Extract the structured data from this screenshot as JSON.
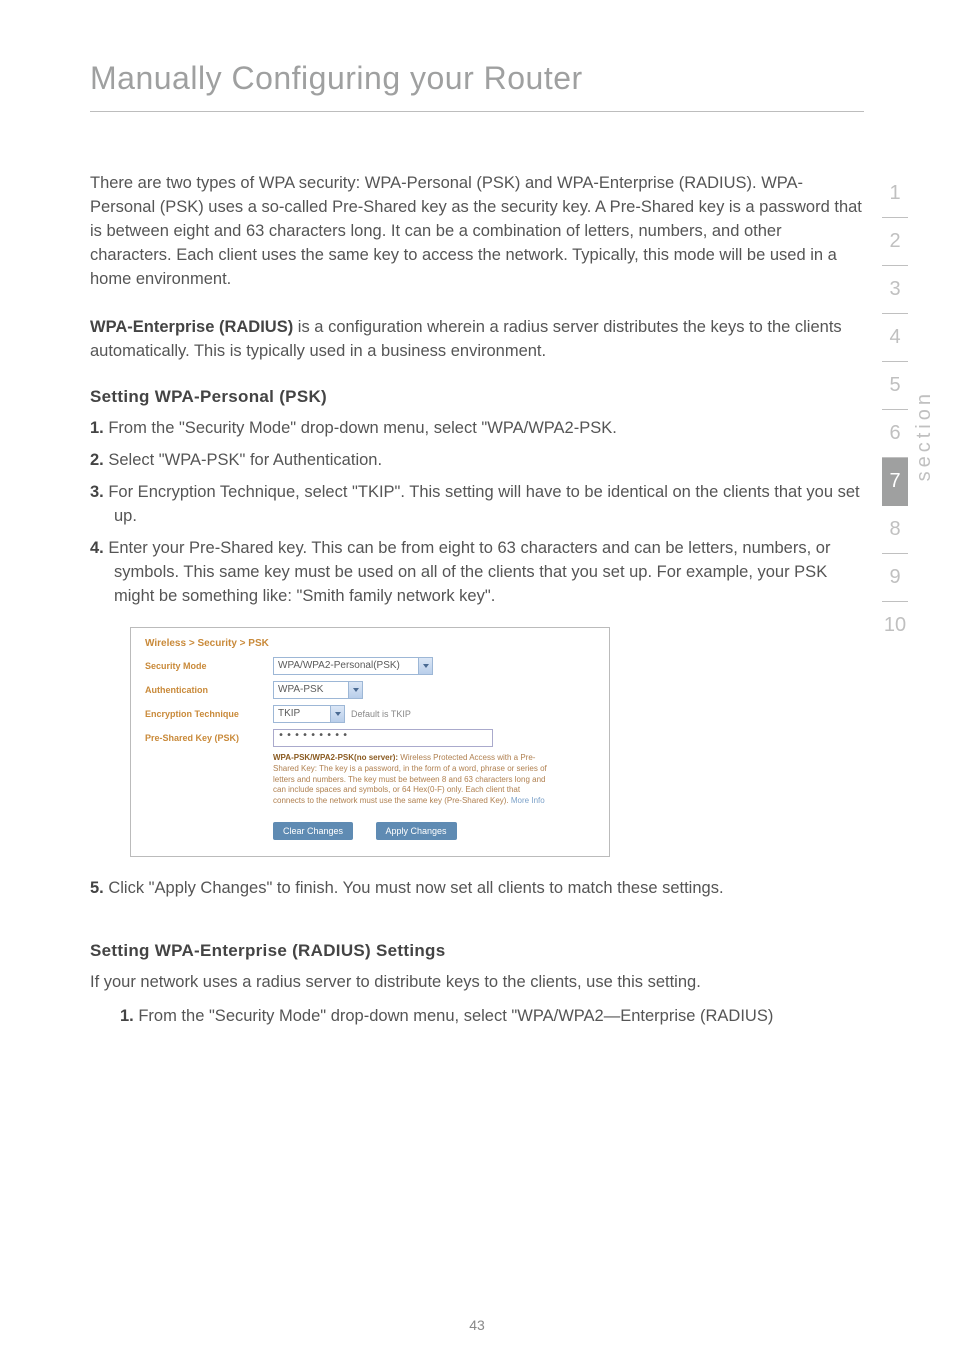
{
  "page_title": "Manually Configuring your Router",
  "para_intro": "There are two types of WPA security: WPA-Personal (PSK) and WPA-Enterprise (RADIUS). WPA-Personal (PSK) uses a so-called Pre-Shared key as the security key. A Pre-Shared key is a password that is between eight and 63 characters long. It can be a combination of letters, numbers, and other characters. Each client uses the same key to access the network. Typically, this mode will be used in a home environment.",
  "wpa_enterprise_label": "WPA-Enterprise (RADIUS)",
  "wpa_enterprise_text": " is a configuration wherein a radius server distributes the keys to the clients automatically. This is typically used in a business environment.",
  "heading_psk": "Setting WPA-Personal (PSK)",
  "psk_steps": {
    "n1": "1.",
    "t1": " From the \"Security Mode\" drop-down menu, select \"WPA/WPA2-PSK.",
    "n2": "2.",
    "t2": " Select \"WPA-PSK\" for Authentication.",
    "n3": "3.",
    "t3": " For Encryption Technique, select \"TKIP\". This setting will have to be identical on the clients that you set up.",
    "n4": "4.",
    "t4": " Enter your Pre-Shared key. This can be from eight to 63 characters and can be letters, numbers, or symbols. This same key must be used on all of the clients that you set up. For example, your PSK might be something like: \"Smith family network key\".",
    "n5": "5.",
    "t5": " Click \"Apply Changes\" to finish. You must now set all clients to match these settings."
  },
  "shot": {
    "breadcrumb": "Wireless > Security > PSK",
    "labels": {
      "security_mode": "Security Mode",
      "authentication": "Authentication",
      "encryption": "Encryption Technique",
      "psk": "Pre-Shared Key (PSK)"
    },
    "values": {
      "security_mode": "WPA/WPA2-Personal(PSK)",
      "authentication": "WPA-PSK",
      "encryption": "TKIP",
      "encryption_hint": "Default is TKIP",
      "psk": "•••••••••"
    },
    "desc_bold": "WPA-PSK/WPA2-PSK(no server): ",
    "desc_text": "Wireless Protected Access with a Pre-Shared Key: The key is a password, in the form of a word, phrase or series of letters and numbers. The key must be between 8 and 63 characters long and can include spaces and symbols, or 64 Hex(0-F) only. Each client that connects to the network must use the same key (Pre-Shared Key). ",
    "desc_link": "More Info",
    "btn_clear": "Clear Changes",
    "btn_apply": "Apply Changes"
  },
  "heading_radius": "Setting WPA-Enterprise (RADIUS) Settings",
  "radius_intro": "If your network uses a radius server to distribute keys to the clients, use this setting.",
  "radius_step": {
    "n1": "1.",
    "t1": " From the \"Security Mode\" drop-down menu, select \"WPA/WPA2—Enterprise (RADIUS)"
  },
  "sidenav": {
    "i1": "1",
    "i2": "2",
    "i3": "3",
    "i4": "4",
    "i5": "5",
    "i6": "6",
    "i7": "7",
    "i8": "8",
    "i9": "9",
    "i10": "10"
  },
  "section_label": "section",
  "page_number": "43"
}
